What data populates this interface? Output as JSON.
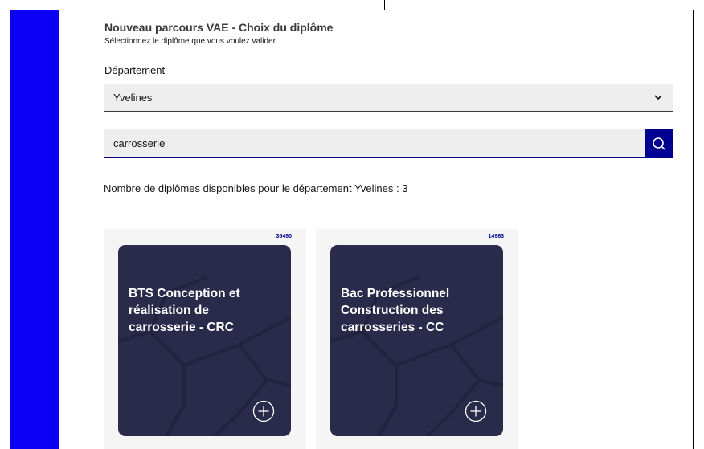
{
  "header": {
    "title": "Nouveau parcours VAE - Choix du diplôme",
    "subtitle": "Sélectionnez le diplôme que vous voulez valider"
  },
  "department": {
    "label": "Département",
    "selected": "Yvelines",
    "chevron_icon": "chevron-down-icon"
  },
  "search": {
    "value": "carrosserie",
    "button_icon": "search-icon"
  },
  "results": {
    "count_text": "Nombre de diplômes disponibles pour le département Yvelines : 3"
  },
  "cards": [
    {
      "code": "35490",
      "title": "BTS Conception et réalisation de carrosserie - CRC",
      "icon": "plus-circle-icon"
    },
    {
      "code": "14963",
      "title": "Bac Professionnel Construction des carrosseries - CC",
      "icon": "plus-circle-icon"
    }
  ],
  "colors": {
    "sidebar": "#0b00f5",
    "accent": "#000091",
    "card": "#2a2b4b"
  }
}
